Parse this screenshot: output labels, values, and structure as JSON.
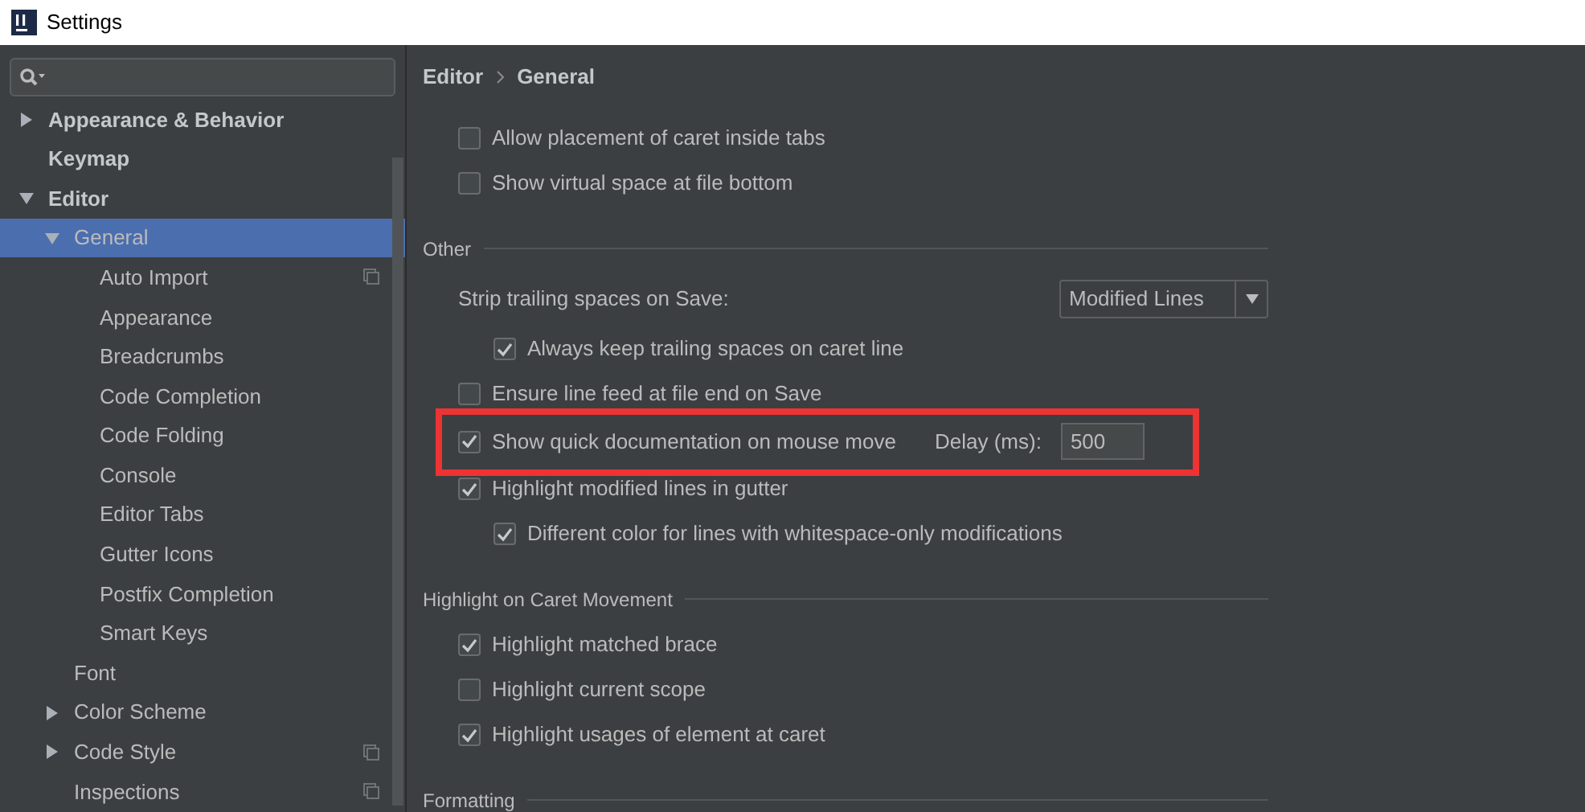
{
  "window": {
    "title": "Settings"
  },
  "sidebar": {
    "items": [
      {
        "label": "Appearance & Behavior",
        "bold": true,
        "expanded": false,
        "has_children": true,
        "selected": false,
        "scoped": false
      },
      {
        "label": "Keymap",
        "bold": true,
        "has_children": false,
        "selected": false,
        "scoped": false
      },
      {
        "label": "Editor",
        "bold": true,
        "expanded": true,
        "has_children": true,
        "selected": false,
        "scoped": false,
        "children": [
          {
            "label": "General",
            "bold": false,
            "expanded": true,
            "has_children": true,
            "selected": true,
            "scoped": false,
            "children": [
              {
                "label": "Auto Import",
                "selected": false,
                "scoped": true
              },
              {
                "label": "Appearance",
                "selected": false,
                "scoped": false
              },
              {
                "label": "Breadcrumbs",
                "selected": false,
                "scoped": false
              },
              {
                "label": "Code Completion",
                "selected": false,
                "scoped": false
              },
              {
                "label": "Code Folding",
                "selected": false,
                "scoped": false
              },
              {
                "label": "Console",
                "selected": false,
                "scoped": false
              },
              {
                "label": "Editor Tabs",
                "selected": false,
                "scoped": false
              },
              {
                "label": "Gutter Icons",
                "selected": false,
                "scoped": false
              },
              {
                "label": "Postfix Completion",
                "selected": false,
                "scoped": false
              },
              {
                "label": "Smart Keys",
                "selected": false,
                "scoped": false
              }
            ]
          },
          {
            "label": "Font",
            "has_children": false,
            "selected": false,
            "scoped": false
          },
          {
            "label": "Color Scheme",
            "has_children": true,
            "expanded": false,
            "selected": false,
            "scoped": false
          },
          {
            "label": "Code Style",
            "has_children": true,
            "expanded": false,
            "selected": false,
            "scoped": true
          },
          {
            "label": "Inspections",
            "has_children": false,
            "selected": false,
            "scoped": true
          }
        ]
      }
    ]
  },
  "breadcrumb": [
    "Editor",
    "General"
  ],
  "content": [
    {
      "kind": "checkbox",
      "label": "Allow placement of caret inside tabs",
      "checked": false
    },
    {
      "kind": "checkbox",
      "label": "Show virtual space at file bottom",
      "checked": false
    },
    {
      "kind": "section",
      "label": "Other"
    },
    {
      "kind": "select",
      "label": "Strip trailing spaces on Save:",
      "value": "Modified Lines",
      "children": [
        {
          "kind": "checkbox",
          "label": "Always keep trailing spaces on caret line",
          "checked": true
        }
      ]
    },
    {
      "kind": "checkbox",
      "label": "Ensure line feed at file end on Save",
      "checked": false
    },
    {
      "kind": "checkbox_field",
      "label": "Show quick documentation on mouse move",
      "checked": true,
      "field_label": "Delay (ms):",
      "value": "500",
      "highlighted": true
    },
    {
      "kind": "checkbox",
      "label": "Highlight modified lines in gutter",
      "checked": true,
      "children": [
        {
          "kind": "checkbox",
          "label": "Different color for lines with whitespace-only modifications",
          "checked": true
        }
      ]
    },
    {
      "kind": "section",
      "label": "Highlight on Caret Movement"
    },
    {
      "kind": "checkbox",
      "label": "Highlight matched brace",
      "checked": true
    },
    {
      "kind": "checkbox",
      "label": "Highlight current scope",
      "checked": false
    },
    {
      "kind": "checkbox",
      "label": "Highlight usages of element at caret",
      "checked": true
    },
    {
      "kind": "section",
      "label": "Formatting"
    }
  ]
}
